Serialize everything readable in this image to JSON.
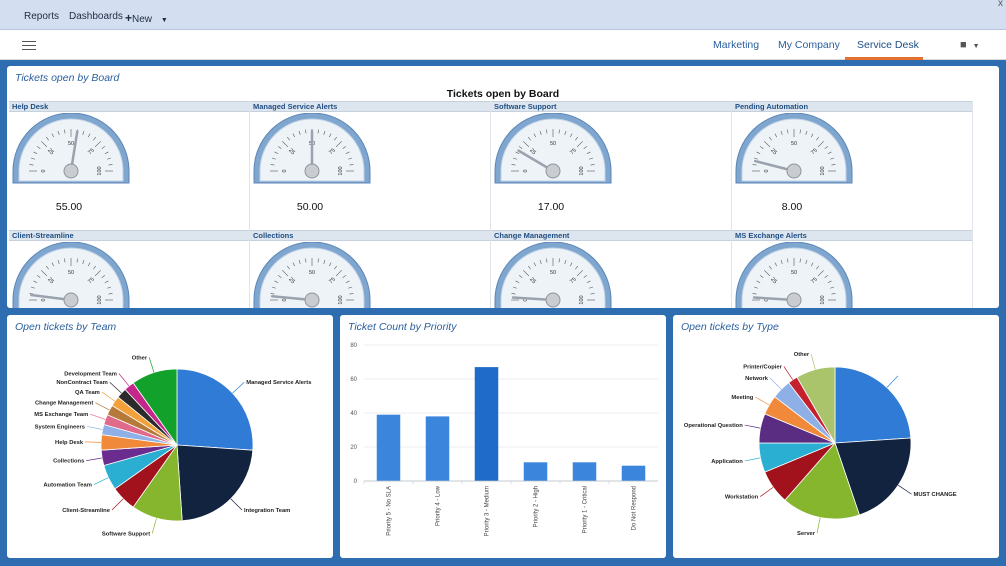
{
  "topbar": {
    "reports": "Reports",
    "dashboards": "Dashboards",
    "new": "New",
    "close": "x"
  },
  "nav": {
    "tabs": [
      "Marketing",
      "My Company",
      "Service Desk"
    ],
    "active_tab": "Service Desk"
  },
  "board_panel": {
    "title": "Tickets open by Board",
    "chart_title": "Tickets open by Board",
    "gauges": [
      {
        "name": "Help Desk",
        "value": 55,
        "display": "55.00"
      },
      {
        "name": "Managed Service Alerts",
        "value": 50,
        "display": "50.00"
      },
      {
        "name": "Software Support",
        "value": 17,
        "display": "17.00"
      },
      {
        "name": "Pending Automation",
        "value": 8,
        "display": "8.00"
      },
      {
        "name": "Client-Streamline",
        "value": 4,
        "display": ""
      },
      {
        "name": "Collections",
        "value": 3,
        "display": ""
      },
      {
        "name": "Change Management",
        "value": 2,
        "display": ""
      },
      {
        "name": "MS Exchange Alerts",
        "value": 2,
        "display": ""
      }
    ],
    "gauge_ticks": [
      "0",
      "25",
      "50",
      "75",
      "100"
    ]
  },
  "chart_data": [
    {
      "type": "pie",
      "title": "Open tickets by Team",
      "slices": [
        {
          "label": "Managed Service Alerts",
          "value": 24,
          "color": "#2f7bd6"
        },
        {
          "label": "Integration Team",
          "value": 21,
          "color": "#12233f"
        },
        {
          "label": "Software Support",
          "value": 10,
          "color": "#86b52e"
        },
        {
          "label": "Client-Streamline",
          "value": 5,
          "color": "#a2121c"
        },
        {
          "label": "Automation Team",
          "value": 5,
          "color": "#2aaed2"
        },
        {
          "label": "Collections",
          "value": 3,
          "color": "#6a2d8f"
        },
        {
          "label": "Help Desk",
          "value": 3,
          "color": "#f08a3a"
        },
        {
          "label": "System Engineers",
          "value": 2,
          "color": "#8fb0e6"
        },
        {
          "label": "MS Exchange Team",
          "value": 2,
          "color": "#e06a8a"
        },
        {
          "label": "Change Management",
          "value": 2,
          "color": "#b57a3a"
        },
        {
          "label": "QA Team",
          "value": 2,
          "color": "#f2a13a"
        },
        {
          "label": "NonContract Team",
          "value": 2,
          "color": "#2b2b2b"
        },
        {
          "label": "Development Team",
          "value": 2,
          "color": "#c4268a"
        },
        {
          "label": "Other",
          "value": 9,
          "color": "#12a12b"
        }
      ]
    },
    {
      "type": "bar",
      "title": "Ticket Count by Priority",
      "categories": [
        "Priority 5 - No SLA",
        "Priority 4 - Low",
        "Priority 3 - Medium",
        "Priority 2 - High",
        "Priority 1 - Critical",
        "Do Not Respond"
      ],
      "values": [
        39,
        38,
        67,
        11,
        11,
        9
      ],
      "colors": [
        "#3b86dc",
        "#3b86dc",
        "#1f6bc9",
        "#3b86dc",
        "#3b86dc",
        "#3b86dc"
      ],
      "ylim": [
        0,
        80
      ],
      "yticks": [
        0,
        20,
        40,
        60,
        80
      ]
    },
    {
      "type": "pie",
      "title": "Open tickets by Type",
      "slices": [
        {
          "label": "",
          "value": 23,
          "color": "#2f7bd6"
        },
        {
          "label": "MUST CHANGE",
          "value": 20,
          "color": "#12233f"
        },
        {
          "label": "Server",
          "value": 16,
          "color": "#86b52e"
        },
        {
          "label": "Workstation",
          "value": 7,
          "color": "#a2121c"
        },
        {
          "label": "Application",
          "value": 6,
          "color": "#2aaed2"
        },
        {
          "label": "Operational Question",
          "value": 6,
          "color": "#5a2d82"
        },
        {
          "label": "Meeting",
          "value": 4,
          "color": "#f08a3a"
        },
        {
          "label": "Network",
          "value": 4,
          "color": "#8fb0e6"
        },
        {
          "label": "Printer/Copier",
          "value": 2,
          "color": "#c4202e"
        },
        {
          "label": "Other",
          "value": 8,
          "color": "#a9c46a"
        }
      ]
    }
  ]
}
